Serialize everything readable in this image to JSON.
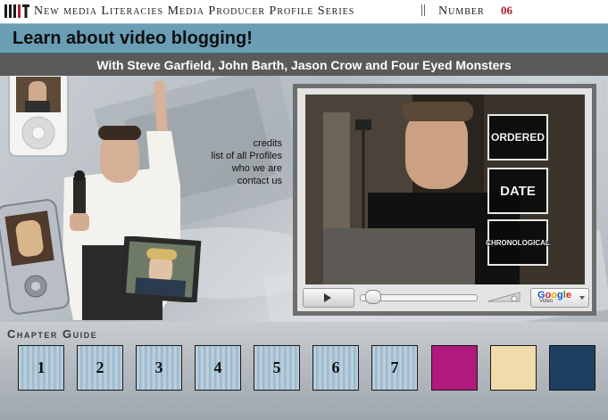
{
  "header": {
    "series_title": "New media Literacies Media Producer Profile Series",
    "separator": "||",
    "number_label": "Number",
    "number_value": "06",
    "logo_icon": "mit-logo",
    "logo_text": "MIT"
  },
  "title_bar": {
    "title": "Learn about video blogging!",
    "background": "#6a9eb4"
  },
  "subtitle_bar": {
    "text": "With Steve Garfield, John Barth, Jason Crow and Four Eyed Monsters",
    "background": "#5a5a5a"
  },
  "nav_links": [
    {
      "label": "credits"
    },
    {
      "label": "list of all Profiles"
    },
    {
      "label": "who we are"
    },
    {
      "label": "contact us"
    }
  ],
  "video_player": {
    "play_icon": "play-icon",
    "stickers": [
      "ORDERED",
      "DATE",
      "CHRONOLOGICAL"
    ],
    "brand": "Google",
    "brand_sub": "Video",
    "dropdown_icon": "chevron-down-icon"
  },
  "chapter_guide": {
    "label": "Chapter Guide",
    "chapters": [
      {
        "label": "1",
        "color": "#8b9fb5"
      },
      {
        "label": "2",
        "color": "#a9c4d8"
      },
      {
        "label": "3",
        "color": "#a8c3d6"
      },
      {
        "label": "4",
        "color": "#b4b7d4"
      },
      {
        "label": "5",
        "color": "#a5bcd2"
      },
      {
        "label": "6",
        "color": "#8aa6c0"
      },
      {
        "label": "7",
        "color": "#9fb3cf"
      },
      {
        "label": "",
        "color": "#b0197e"
      },
      {
        "label": "",
        "color": "#f1dbaa"
      },
      {
        "label": "",
        "color": "#1f3f60"
      }
    ]
  }
}
